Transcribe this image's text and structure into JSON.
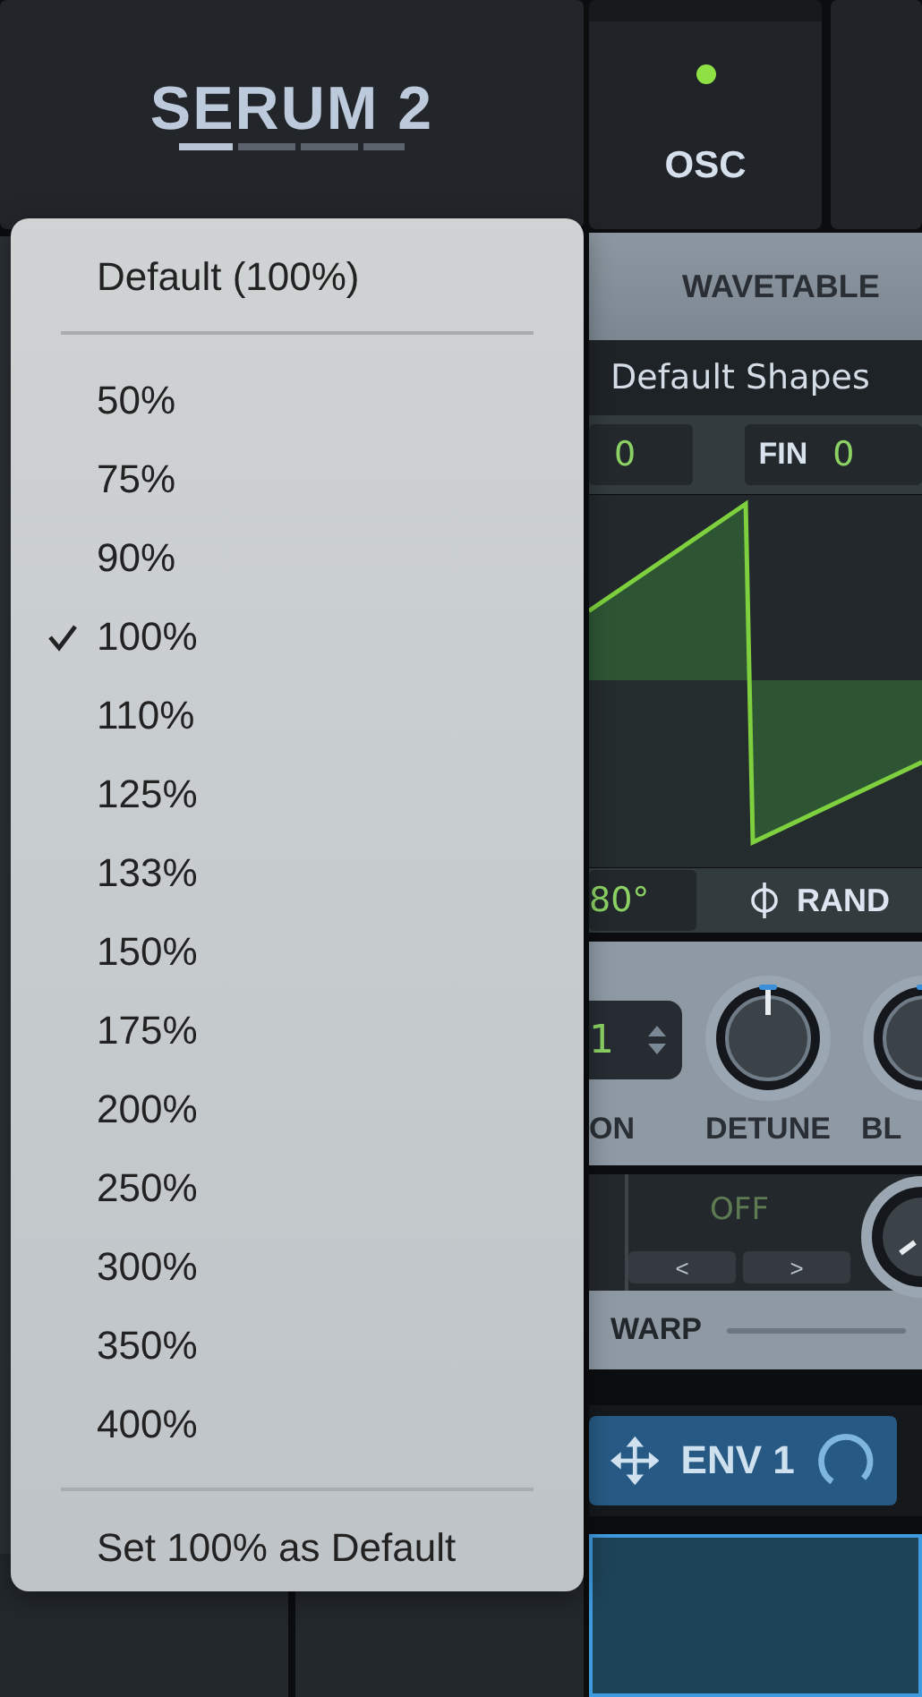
{
  "header": {
    "logo": "SERUM 2",
    "tabs": [
      {
        "label": "OSC",
        "on": true
      }
    ]
  },
  "wavetable": {
    "title": "WAVETABLE",
    "table_name": "Default Shapes",
    "fields": [
      {
        "value": "0"
      },
      {
        "label": "FIN",
        "value": "0"
      }
    ],
    "phase_value": "80°",
    "rand_label": "RAND"
  },
  "voice": {
    "unison_value": "1",
    "unison_label": "ON",
    "knobs": [
      {
        "label": "DETUNE"
      },
      {
        "label": "BL"
      }
    ]
  },
  "warp": {
    "mode": "OFF",
    "prev": "<",
    "next": ">",
    "label": "WARP"
  },
  "mod_tab": {
    "label": "ENV 1"
  },
  "menu": {
    "default_item": "Default (100%)",
    "options": [
      {
        "label": "50%",
        "checked": false
      },
      {
        "label": "75%",
        "checked": false
      },
      {
        "label": "90%",
        "checked": false
      },
      {
        "label": "100%",
        "checked": true
      },
      {
        "label": "110%",
        "checked": false
      },
      {
        "label": "125%",
        "checked": false
      },
      {
        "label": "133%",
        "checked": false
      },
      {
        "label": "150%",
        "checked": false
      },
      {
        "label": "175%",
        "checked": false
      },
      {
        "label": "200%",
        "checked": false
      },
      {
        "label": "250%",
        "checked": false
      },
      {
        "label": "300%",
        "checked": false
      },
      {
        "label": "350%",
        "checked": false
      },
      {
        "label": "400%",
        "checked": false
      }
    ],
    "footer_item": "Set 100% as Default"
  }
}
